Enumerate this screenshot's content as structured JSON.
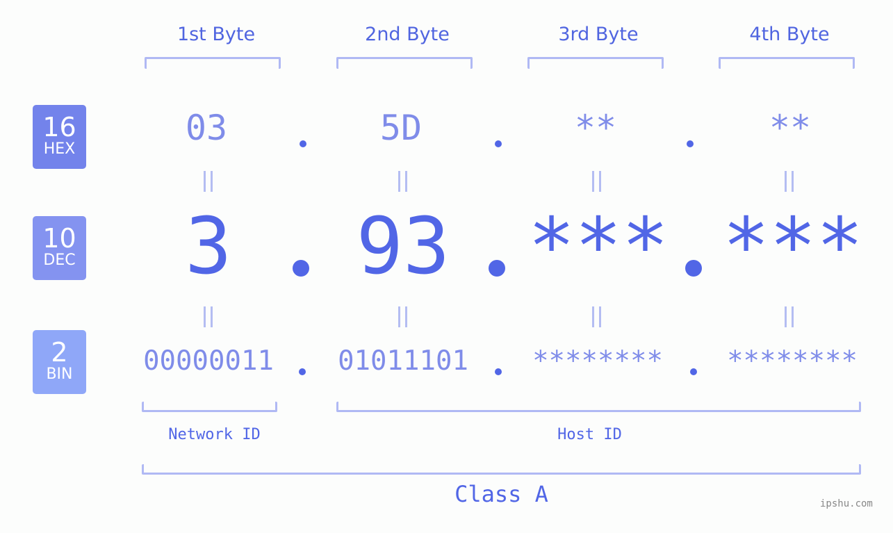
{
  "columns": [
    "1st Byte",
    "2nd Byte",
    "3rd Byte",
    "4th Byte"
  ],
  "badges": [
    {
      "num": "16",
      "unit": "HEX",
      "color": "#7383eb"
    },
    {
      "num": "10",
      "unit": "DEC",
      "color": "#8493f0"
    },
    {
      "num": "2",
      "unit": "BIN",
      "color": "#8fa7f8"
    }
  ],
  "hex": [
    "03",
    "5D",
    "**",
    "**"
  ],
  "dec": [
    "3",
    "93",
    "***",
    "***"
  ],
  "bin": [
    "00000011",
    "01011101",
    "********",
    "********"
  ],
  "separator": ".",
  "network_label": "Network ID",
  "host_label": "Host ID",
  "class_label": "Class A",
  "watermark": "ipshu.com"
}
